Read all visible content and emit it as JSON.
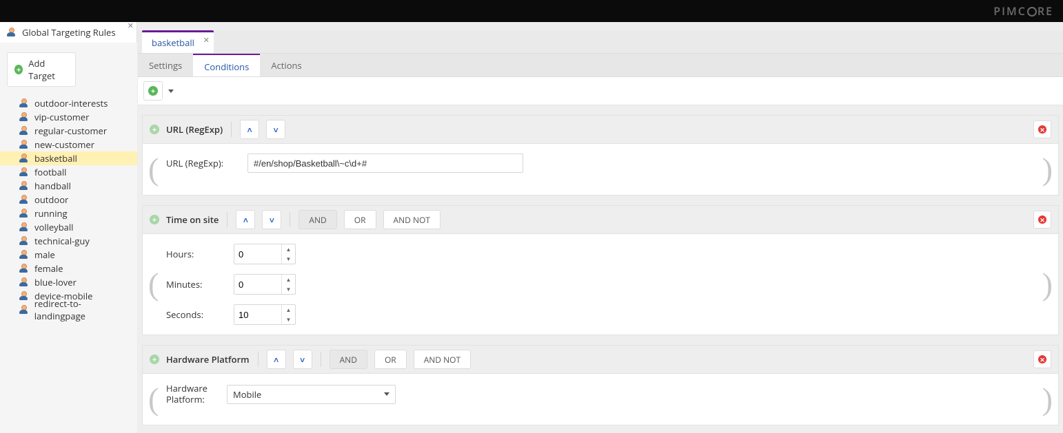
{
  "brand": "PIMCORE",
  "sidebar": {
    "title": "Global Targeting Rules",
    "add_label": "Add Target",
    "items": [
      "outdoor-interests",
      "vip-customer",
      "regular-customer",
      "new-customer",
      "basketball",
      "football",
      "handball",
      "outdoor",
      "running",
      "volleyball",
      "technical-guy",
      "male",
      "female",
      "blue-lover",
      "device-mobile",
      "redirect-to-landingpage"
    ],
    "selected_index": 4
  },
  "editor": {
    "tab_label": "basketball",
    "subtabs": {
      "settings": "Settings",
      "conditions": "Conditions",
      "actions": "Actions",
      "active": "conditions"
    },
    "operators": {
      "and": "AND",
      "or": "OR",
      "and_not": "AND NOT"
    }
  },
  "conditions": [
    {
      "type": "url_regexp",
      "title": "URL (RegExp)",
      "show_operators": false,
      "fields": {
        "url": {
          "label": "URL (RegExp):",
          "value": "#/en/shop/Basketball\\~c\\d+#"
        }
      }
    },
    {
      "type": "time_on_site",
      "title": "Time on site",
      "show_operators": true,
      "active_op": "and",
      "fields": {
        "hours": {
          "label": "Hours:",
          "value": "0"
        },
        "minutes": {
          "label": "Minutes:",
          "value": "0"
        },
        "seconds": {
          "label": "Seconds:",
          "value": "10"
        }
      }
    },
    {
      "type": "hardware_platform",
      "title": "Hardware Platform",
      "show_operators": true,
      "active_op": "and",
      "fields": {
        "platform": {
          "label": "Hardware Platform:",
          "value": "Mobile"
        }
      }
    }
  ]
}
